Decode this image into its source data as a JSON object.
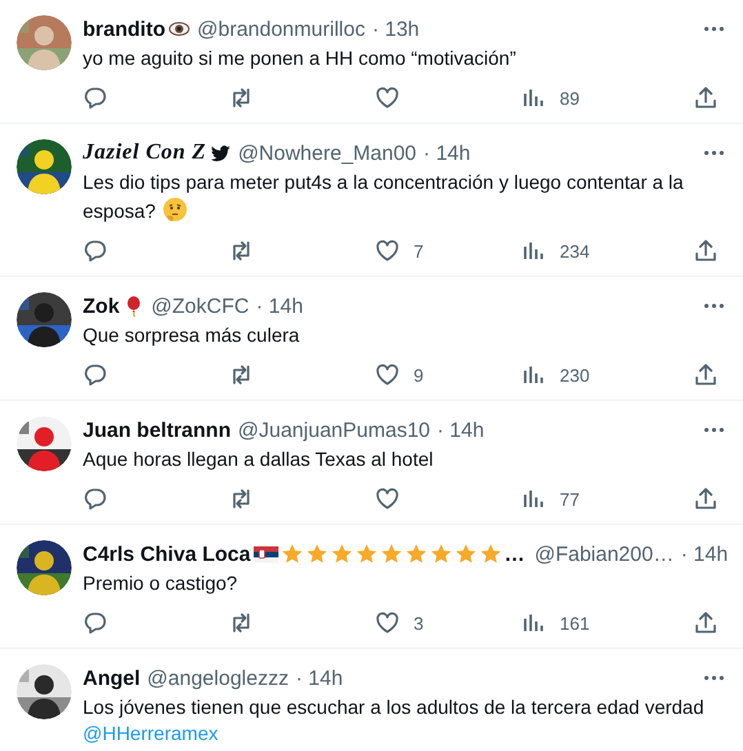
{
  "tweets": [
    {
      "author": {
        "kind": "plain",
        "name": "brandito"
      },
      "badges": [
        {
          "kind": "eye"
        }
      ],
      "handle": "@brandonmurilloc",
      "time": "· 13h",
      "text": "yo me aguito si me ponen a HH como “motivación”",
      "actions": {
        "views": "89"
      }
    },
    {
      "author": {
        "kind": "script",
        "name": "Jaziel Con Z"
      },
      "badges": [
        {
          "kind": "bird"
        }
      ],
      "handle": "@Nowhere_Man00",
      "time": "· 14h",
      "text": "Les dio tips para meter put4s a la concentración y luego contentar a la esposa?",
      "emoji": {
        "kind": "thinking"
      },
      "actions": {
        "likes": "7",
        "views": "234"
      }
    },
    {
      "author": {
        "kind": "plain",
        "name": "Zok"
      },
      "badges": [
        {
          "kind": "balloon"
        }
      ],
      "handle": "@ZokCFC",
      "time": "· 14h",
      "text": "Que sorpresa más culera",
      "actions": {
        "likes": "9",
        "views": "230"
      }
    },
    {
      "author": {
        "kind": "plain",
        "name": "Juan beltrannn"
      },
      "handle": "@JuanjuanPumas10",
      "time": "· 14h",
      "text": "Aque horas llegan a dallas Texas al hotel",
      "actions": {
        "views": "77"
      }
    },
    {
      "author": {
        "kind": "plain",
        "name": "C4rls Chiva Loca"
      },
      "badges": [
        {
          "kind": "flag"
        },
        {
          "kind": "star"
        },
        {
          "kind": "star"
        },
        {
          "kind": "star"
        },
        {
          "kind": "star"
        },
        {
          "kind": "star"
        },
        {
          "kind": "star"
        },
        {
          "kind": "star"
        },
        {
          "kind": "star"
        },
        {
          "kind": "star"
        }
      ],
      "name_cut": "…",
      "handle": "@Fabian200…",
      "time": "· 14h",
      "text": "Premio o castigo?",
      "actions": {
        "likes": "3",
        "views": "161"
      }
    },
    {
      "author": {
        "kind": "plain",
        "name": "Angel"
      },
      "handle": "@angeloglezzz",
      "time": "· 14h",
      "text": "Los jóvenes tienen que escuchar a los adultos de la tercera edad verdad",
      "mention": "@HHerreramex"
    }
  ]
}
